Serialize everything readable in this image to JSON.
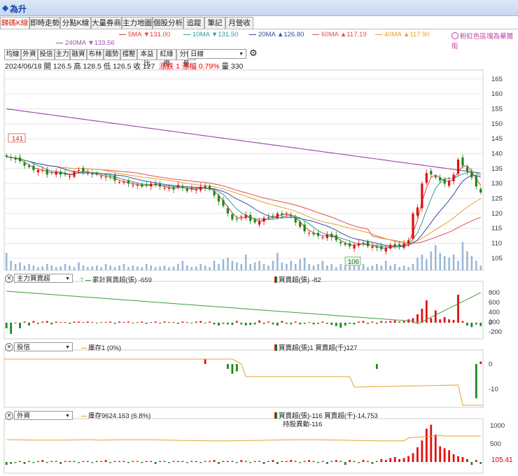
{
  "title": "為升",
  "tabs": [
    {
      "label": "歸碼K線",
      "active": true
    },
    {
      "label": "即時走勢",
      "active": false
    },
    {
      "label": "分點K線",
      "active": false
    },
    {
      "label": "大量券商",
      "active": false
    },
    {
      "label": "主力地圖",
      "active": false
    },
    {
      "label": "個股分析",
      "active": false
    },
    {
      "label": "追蹤",
      "active": false
    },
    {
      "label": "筆記",
      "active": false
    },
    {
      "label": "月營收",
      "active": false
    }
  ],
  "ma_legend": [
    {
      "text": "5MA ▼131.00",
      "color": "#e0403a"
    },
    {
      "text": "10MA ▼131.50",
      "color": "#2aa198"
    },
    {
      "text": "20MA ▲126.80",
      "color": "#3a4aa0"
    },
    {
      "text": "60MA ▲117.19",
      "color": "#e05050"
    },
    {
      "text": "40MA ▲117.90",
      "color": "#e8a030"
    },
    {
      "text": "240MA ▼133.56",
      "color": "#a050b0"
    }
  ],
  "note": "粉紅色區塊為華爾街",
  "toolbar": [
    "均線",
    "外資",
    "投信",
    "主力",
    "融資",
    "布林",
    "趨勢",
    "撐壓",
    "本益比",
    "紅綠燈",
    "分價量"
  ],
  "toolbar_select": "日線",
  "quote": {
    "date": "2024/06/18",
    "open_label": "開",
    "open": "126.5",
    "high_label": "高",
    "high": "128.5",
    "low_label": "低",
    "low": "126.5",
    "close_label": "收",
    "close": "127",
    "chg_label": "漲跌",
    "chg": "1",
    "pct_label": "漲幅",
    "pct": "0.79%",
    "vol_label": "量",
    "vol": "330"
  },
  "colors": {
    "up": "#e01010",
    "down": "#1a8a1a",
    "ma5": "#e0403a",
    "ma10": "#2aa198",
    "ma20": "#3a4aa0",
    "ma60": "#e05050",
    "ma40": "#e8a030",
    "ma240": "#a050b0",
    "vol": "#9ab8d8",
    "grid": "#e6e6e6",
    "inventory": "#e8a030",
    "cum": "#3aa03a"
  },
  "panel1": {
    "select": "主力買賣超",
    "legend_line": "累計買賣超(張) -659",
    "legend_bar": "買賣超(張) -82"
  },
  "panel2": {
    "select": "投信",
    "legend_line": "庫存1 (0%)",
    "legend_bar": "買賣超(張)1 買賣超(千)127"
  },
  "panel3": {
    "select": "外資",
    "legend_line": "庫存9624.163 (6.8%)",
    "legend_bar": "買賣超(張)-116 買賣超(千)-14,753",
    "legend_sub": "持股異動-116"
  },
  "callouts": {
    "high": "141",
    "low": "106",
    "last": "105.41"
  },
  "chart_data": {
    "type": "candlestick",
    "date": "2024/06/18",
    "ylim": [
      101,
      168
    ],
    "yticks": [
      105,
      110,
      115,
      120,
      125,
      130,
      135,
      140,
      145,
      150,
      155,
      160,
      165
    ],
    "annotations": {
      "period_high": 141,
      "period_low": 106
    },
    "ohlc_closes": [
      139,
      138.5,
      138,
      137.5,
      136,
      135.5,
      134.5,
      134.5,
      134.5,
      133,
      133.5,
      134,
      133,
      133,
      132.5,
      134,
      134.5,
      134,
      133.5,
      133,
      133,
      132.5,
      132,
      132,
      131,
      130.5,
      130.5,
      130,
      129.5,
      129.5,
      129,
      129.5,
      130,
      129.5,
      129,
      128.5,
      128.5,
      128,
      129.5,
      128.5,
      127.5,
      128.5,
      128,
      129,
      128.5,
      128,
      126,
      124,
      122.5,
      120,
      118,
      118,
      119,
      119.5,
      117.5,
      117,
      117.5,
      118.5,
      118.5,
      119,
      120,
      119.5,
      120,
      119,
      117,
      115.5,
      114,
      113.5,
      113,
      112.5,
      112,
      113,
      112,
      111,
      110,
      109.5,
      109,
      109.5,
      110,
      110,
      109,
      109,
      108.5,
      108,
      108.5,
      109.5,
      109,
      109,
      110,
      111,
      120,
      122,
      130,
      133.5,
      133,
      132,
      131,
      130,
      131,
      133,
      138,
      136,
      134,
      132,
      129,
      127
    ],
    "volume": [
      0.55,
      0.3,
      0.2,
      0.25,
      0.15,
      0.2,
      0.15,
      0.1,
      0.12,
      0.2,
      0.15,
      0.1,
      0.12,
      0.2,
      0.15,
      0.1,
      0.25,
      0.15,
      0.1,
      0.12,
      0.15,
      0.1,
      0.2,
      0.15,
      0.1,
      0.15,
      0.2,
      0.1,
      0.15,
      0.12,
      0.1,
      0.2,
      0.15,
      0.1,
      0.12,
      0.15,
      0.1,
      0.12,
      0.2,
      0.3,
      0.15,
      0.1,
      0.12,
      0.2,
      0.15,
      0.1,
      0.3,
      0.2,
      0.35,
      0.4,
      0.3,
      0.25,
      0.2,
      0.5,
      0.2,
      0.25,
      0.3,
      0.2,
      0.15,
      0.3,
      0.55,
      0.25,
      0.2,
      0.3,
      0.2,
      0.35,
      0.4,
      0.2,
      0.15,
      0.2,
      0.3,
      0.15,
      0.2,
      0.1,
      0.2,
      0.15,
      0.25,
      0.3,
      0.15,
      0.2,
      0.1,
      0.15,
      0.2,
      0.15,
      0.3,
      0.15,
      0.2,
      0.1,
      0.15,
      0.1,
      0.2,
      0.4,
      0.5,
      0.35,
      0.6,
      0.8,
      0.55,
      0.45,
      0.4,
      0.5,
      0.3,
      0.9,
      0.6,
      0.45,
      0.3,
      0.15
    ],
    "main_force_net": [
      -1,
      -2,
      0,
      -1,
      0.2,
      -0.5,
      0.3,
      -0.2,
      0.2,
      0.3,
      -0.3,
      0.2,
      0.1,
      0.1,
      -0.2,
      0.2,
      0.2,
      0.1,
      0.2,
      0.1,
      -0.1,
      0.1,
      0.1,
      0.2,
      -0.2,
      0.2,
      0.1,
      0.2,
      -0.1,
      0.1,
      0.2,
      -0.2,
      0.1,
      0.2,
      -0.1,
      0.2,
      0.1,
      0.1,
      -0.2,
      0.2,
      0.1,
      -0.1,
      0.2,
      0.3,
      -0.1,
      0.2,
      -0.3,
      -0.5,
      -0.2,
      -0.3,
      -0.4,
      0.3,
      -0.3,
      -0.5,
      -0.4,
      -0.3,
      0.4,
      -0.2,
      0.2,
      -0.3,
      -0.5,
      0.3,
      -0.2,
      -0.3,
      0.2,
      -0.3,
      -0.2,
      0.1,
      -0.3,
      -0.2,
      0.2,
      -0.2,
      -0.4,
      -0.6,
      -0.9,
      -0.5,
      -0.2,
      -0.3,
      0.2,
      0.3,
      -0.2,
      0.2,
      -0.2,
      0.3,
      0.2,
      0.3,
      0.4,
      0.2,
      0.3,
      0.6,
      0.8,
      1.5,
      2.5,
      4,
      0.8,
      2.2,
      0.6,
      1.0,
      0.6,
      0.5,
      5,
      0.3,
      -0.5,
      -0.8,
      -0.3,
      -0.6
    ],
    "trust_net": [
      0,
      0,
      0,
      0,
      0,
      0,
      0,
      0,
      0,
      0,
      0,
      0,
      0,
      0,
      0,
      0,
      0,
      0,
      0,
      0,
      0,
      0,
      0,
      0,
      0,
      0,
      0,
      0,
      0,
      0,
      0,
      0,
      0,
      0,
      0,
      0,
      0,
      0,
      0,
      0,
      0,
      0,
      0,
      0,
      1,
      0,
      0,
      0,
      0,
      -1,
      -2,
      -1.5,
      0,
      0,
      0,
      0,
      0,
      0,
      0,
      0,
      0,
      0,
      0,
      0,
      0,
      0,
      0,
      0,
      0,
      0,
      0,
      0,
      0,
      0,
      0,
      0,
      0,
      0,
      0,
      0,
      0,
      0,
      -1,
      0,
      0,
      0,
      0,
      0,
      0,
      0,
      0,
      0,
      0,
      0,
      0,
      0,
      0,
      0,
      0,
      0,
      0,
      0,
      0,
      0,
      -7,
      0.5
    ],
    "foreign_net": [
      -0.3,
      -0.2,
      -0.1,
      0.1,
      -0.2,
      0.1,
      -0.1,
      0.1,
      0.2,
      -0.1,
      0.1,
      0.1,
      -0.2,
      0.1,
      0.1,
      0.1,
      -0.1,
      0.1,
      0.1,
      -0.1,
      0.1,
      0.1,
      0.2,
      -0.1,
      0.1,
      0.1,
      0.1,
      -0.1,
      0.1,
      0.1,
      -0.1,
      0.1,
      0.1,
      -0.2,
      0.1,
      0.1,
      -0.1,
      0.1,
      0.1,
      0.1,
      -0.1,
      0.1,
      0.1,
      -0.1,
      0.1,
      0.1,
      0.2,
      -0.2,
      0.1,
      0.1,
      0.1,
      -0.1,
      0.2,
      0.1,
      -0.1,
      0.1,
      0.1,
      -0.2,
      0.1,
      0.2,
      -0.2,
      0.1,
      0.1,
      0.2,
      0.1,
      -0.1,
      0.1,
      0.2,
      0.1,
      -0.1,
      0.1,
      -0.2,
      0.1,
      0.2,
      0.1,
      -0.3,
      0.2,
      0.1,
      -0.1,
      0.2,
      0.1,
      -0.2,
      0.1,
      0.3,
      0.2,
      0.4,
      0.5,
      0.3,
      0.4,
      0.6,
      0.9,
      1.5,
      2.2,
      3.4,
      3.8,
      2.8,
      1.6,
      1.4,
      1.2,
      0.8,
      0.6,
      0.5,
      0.3,
      -0.3,
      0.2,
      -0.2
    ]
  }
}
